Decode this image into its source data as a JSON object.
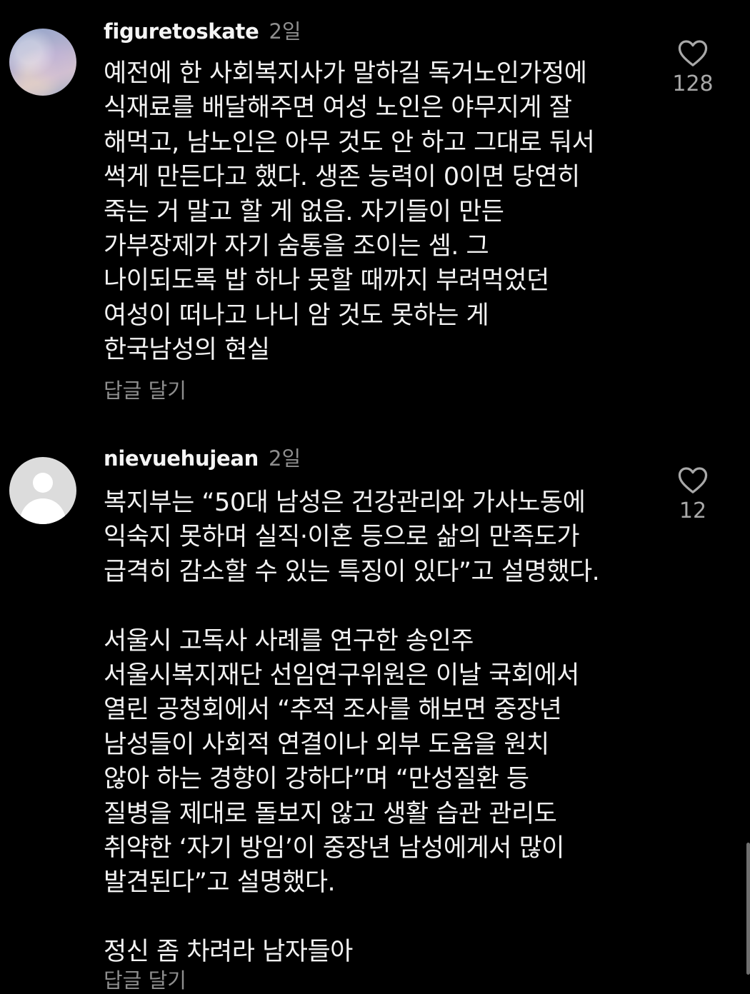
{
  "comments": [
    {
      "username": "figuretoskate",
      "time": "2일",
      "lines": [
        "예전에 한 사회복지사가 말하길 독거노인가정에",
        "식재료를 배달해주면 여성 노인은 야무지게 잘",
        "해먹고, 남노인은 아무 것도 안 하고 그대로 둬서",
        "썩게 만든다고 했다. 생존 능력이 0이면 당연히",
        "죽는 거 말고 할 게 없음. 자기들이 만든",
        "가부장제가 자기 숨통을 조이는 셈. 그",
        "나이되도록 밥 하나 못할 때까지 부려먹었던",
        "여성이 떠나고 나니 암 것도 못하는 게",
        "한국남성의 현실"
      ],
      "reply_label": "답글 달기",
      "like_count": "128",
      "avatar_icon": "sky-photo-avatar"
    },
    {
      "username": "nievuehujean",
      "time": "2일",
      "lines": [
        "복지부는 “50대 남성은 건강관리와 가사노동에",
        "익숙지 못하며 실직·이혼 등으로 삶의 만족도가",
        "급격히 감소할 수 있는 특징이 있다”고 설명했다.",
        "",
        "서울시 고독사 사례를 연구한 송인주",
        "서울시복지재단 선임연구위원은 이날 국회에서",
        "열린 공청회에서 “추적 조사를 해보면 중장년",
        "남성들이 사회적 연결이나 외부 도움을 원치",
        "않아 하는 경향이 강하다”며 “만성질환 등",
        "질병을 제대로 돌보지 않고 생활 습관 관리도",
        "취약한 ‘자기 방임’이 중장년 남성에게서 많이",
        "발견된다”고 설명했다.",
        "",
        "정신 좀 차려라 남자들아"
      ],
      "reply_label": "답글 달기",
      "like_count": "12",
      "avatar_icon": "default-user-avatar"
    }
  ],
  "colors": {
    "background": "#000000",
    "text": "#f2f2f2",
    "secondary": "#8e8e8e"
  }
}
